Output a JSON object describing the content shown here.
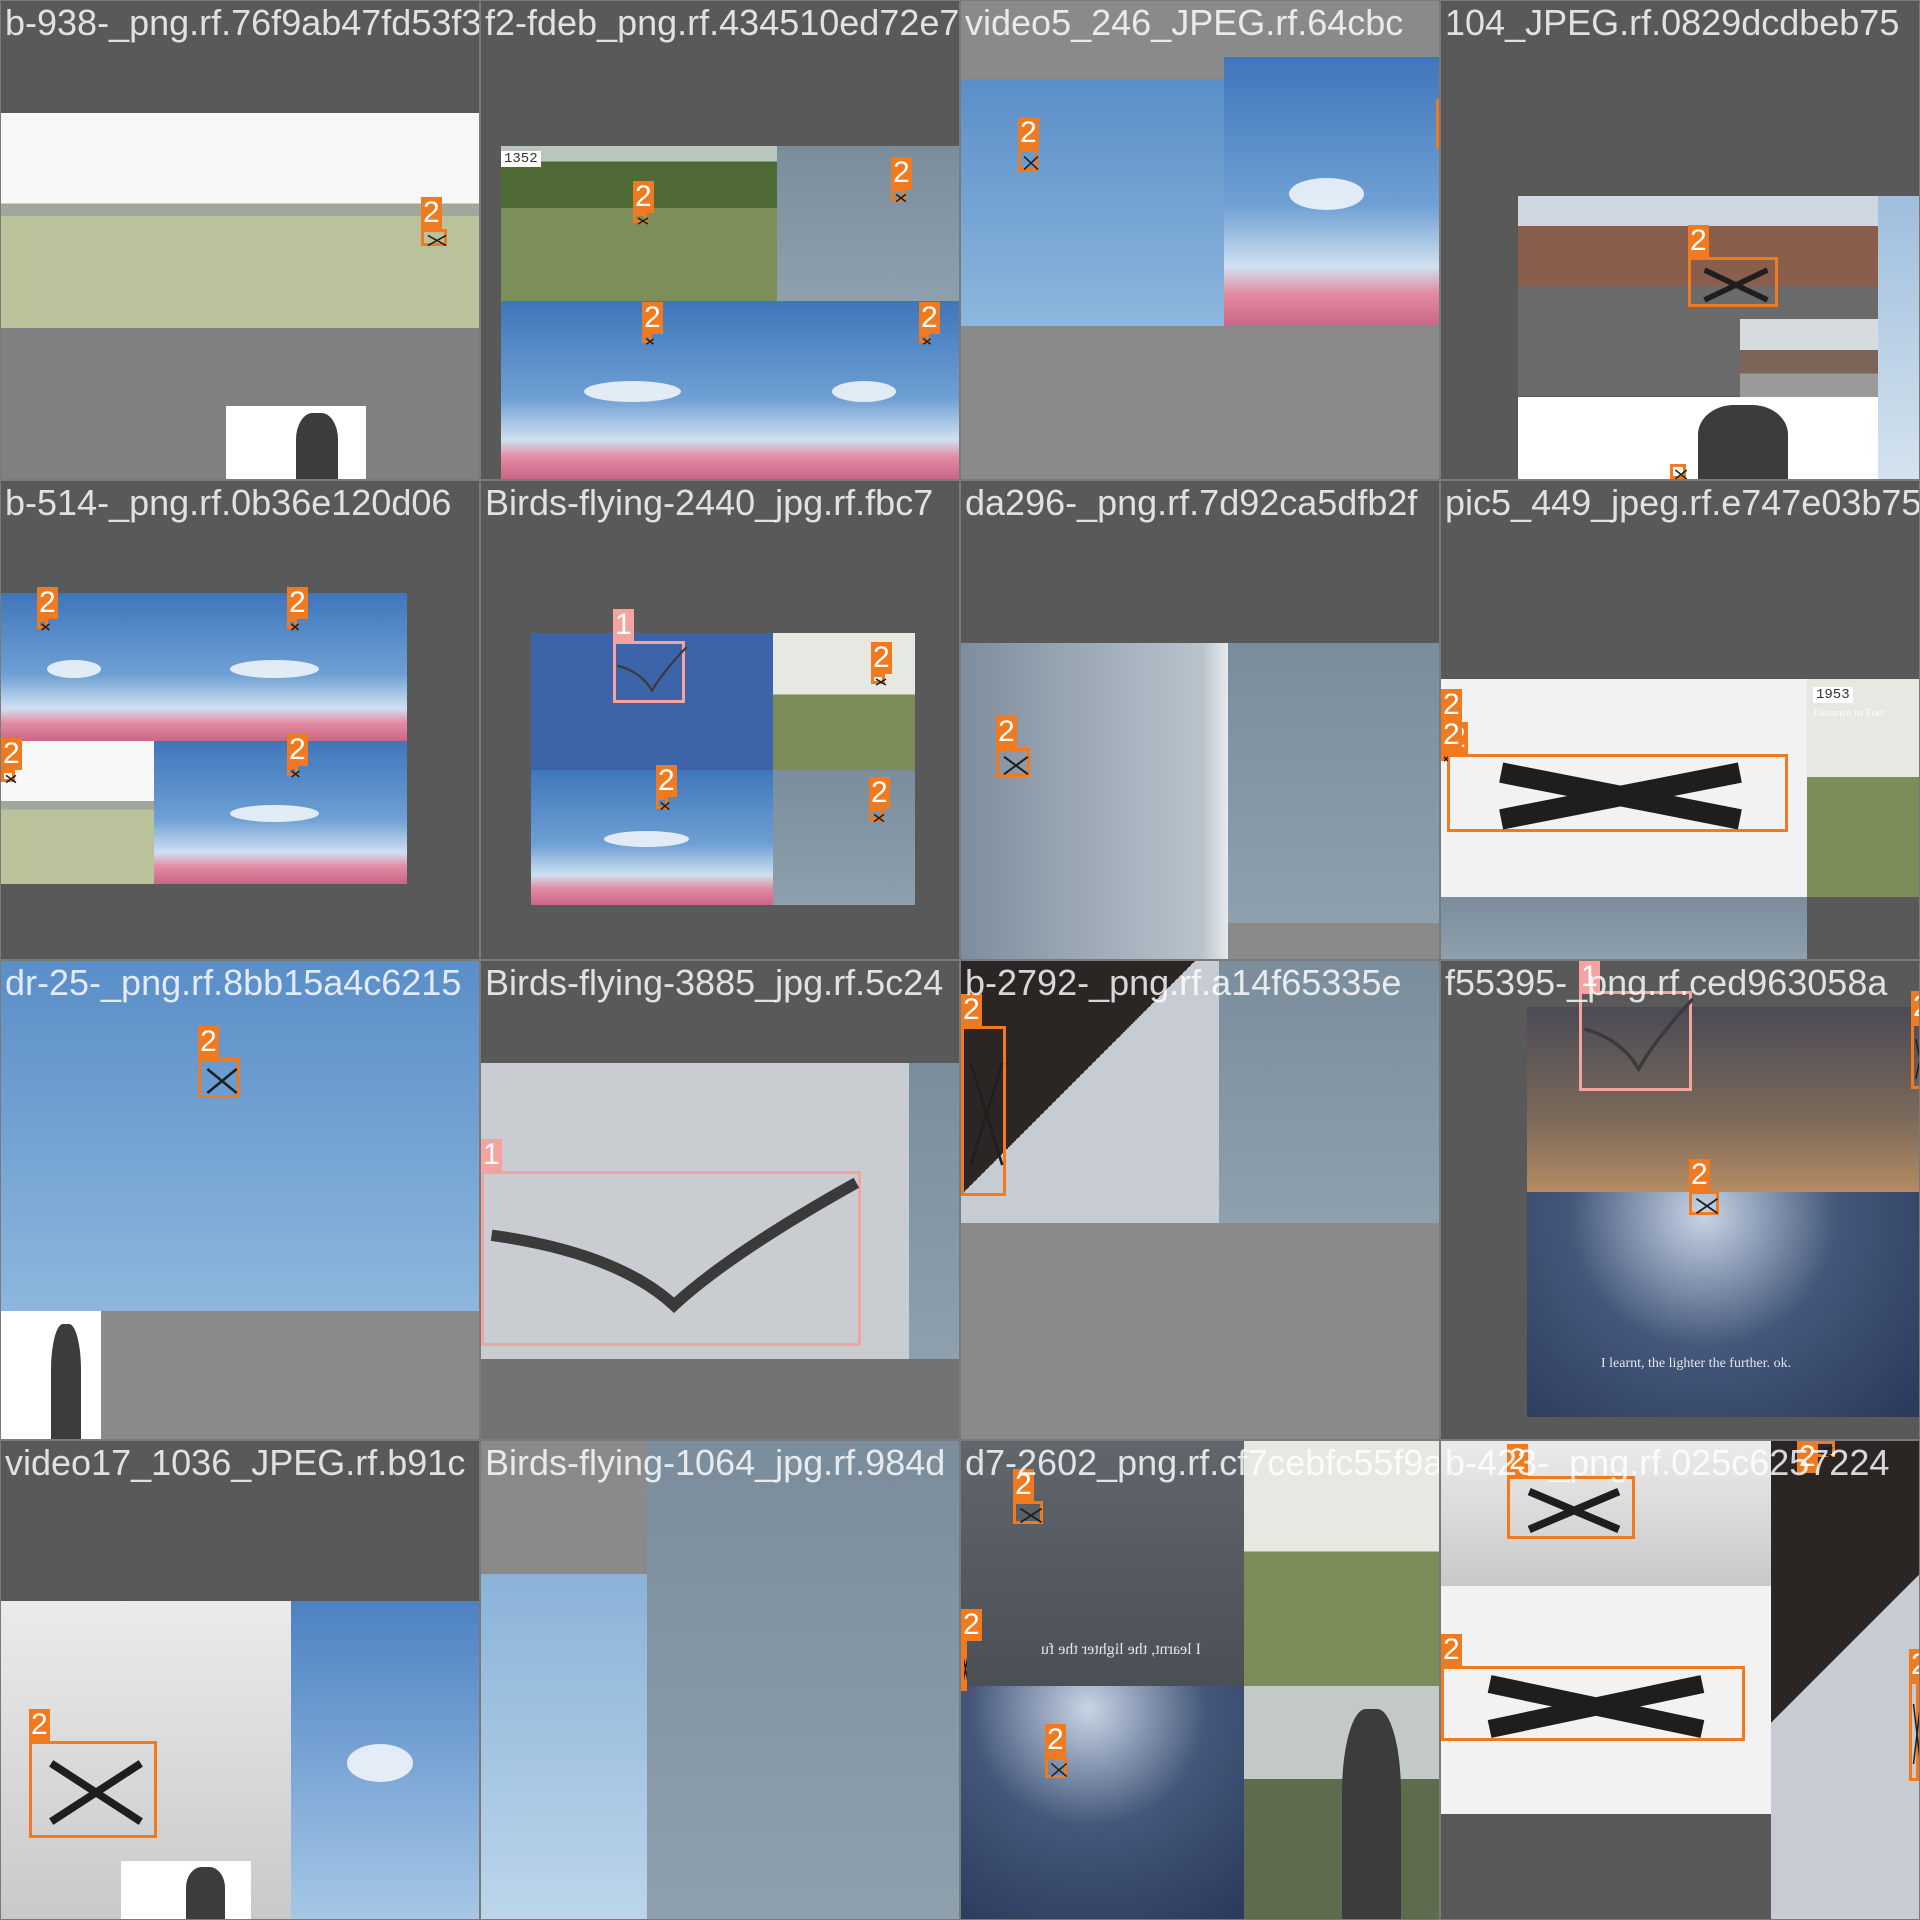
{
  "colors": {
    "drone_box": "#f07a20",
    "bird_box": "#f5a3a0",
    "pad_dark": "#595959",
    "pad_mid": "#727272",
    "pad_light": "#8a8a8a"
  },
  "tiles": [
    {
      "filename": "b-938-_png.rf.76f9ab47fd53f3238db08bef7",
      "scenes": [
        "field-with-operator",
        "operator-lower"
      ],
      "labels": [
        "2"
      ]
    },
    {
      "filename": "f2-fdeb_png.rf.434510ed72e785016",
      "scenes": [
        "aerial-field",
        "flat-sky",
        "sky-with-blossoms",
        "sky-with-blossoms"
      ],
      "overlay_number": "1352",
      "labels": [
        "2",
        "2",
        "2",
        "2"
      ]
    },
    {
      "filename": "video5_246_JPEG.rf.64cbc",
      "scenes": [
        "clear-sky",
        "sky-with-blossoms"
      ],
      "labels": [
        "2",
        "2"
      ]
    },
    {
      "filename": "104_JPEG.rf.0829dcdbeb75",
      "scenes": [
        "parking-lot",
        "building-with-trucks",
        "operator-lower",
        "sky-edge"
      ],
      "labels": [
        "2",
        "2"
      ]
    },
    {
      "filename": "b-514-_png.rf.0b36e120d06",
      "scenes": [
        "sky-with-blossoms",
        "sky-with-blossoms",
        "field-with-operator",
        "sky-with-blossoms"
      ],
      "labels": [
        "2",
        "2",
        "2",
        "2"
      ]
    },
    {
      "filename": "Birds-flying-2440_jpg.rf.fbc7",
      "scenes": [
        "bird-blue-sky",
        "grass-field",
        "sky-with-blossoms",
        "flat-sky"
      ],
      "labels": [
        "1",
        "2",
        "2",
        "2"
      ]
    },
    {
      "filename": "da296-_png.rf.7d92ca5dfb2f",
      "scenes": [
        "overcast-sky",
        "flat-sky"
      ],
      "labels": [
        "2"
      ]
    },
    {
      "filename": "pic5_449_jpeg.rf.e747e03b7561",
      "scenes": [
        "product-drone",
        "grass-field",
        "flat-sky"
      ],
      "overlay_number": "1953",
      "overlay_caption": "Distance in Feet",
      "labels": [
        "2",
        "2",
        "2"
      ]
    },
    {
      "filename": "dr-25-_png.rf.8bb15a4c6215",
      "scenes": [
        "clear-sky",
        "operator-head"
      ],
      "labels": [
        "2"
      ]
    },
    {
      "filename": "Birds-flying-3885_jpg.rf.5c24",
      "scenes": [
        "gull-grey-sky",
        "flat-sky"
      ],
      "labels": [
        "1"
      ]
    },
    {
      "filename": "b-2792-_png.rf.a14f65335e",
      "scenes": [
        "building-low-angle",
        "flat-sky"
      ],
      "labels": [
        "2"
      ]
    },
    {
      "filename": "f55395-_png.rf.ced963058a",
      "scenes": [
        "pigeon-sunset",
        "dark-sky-drone"
      ],
      "overlay_caption": "I learnt, the lighter the further. ok.",
      "labels": [
        "1",
        "2",
        "2"
      ]
    },
    {
      "filename": "video17_1036_JPEG.rf.b91c",
      "scenes": [
        "drone-below-buildings",
        "sky-with-trees",
        "operator-lower"
      ],
      "labels": [
        "2"
      ]
    },
    {
      "filename": "Birds-flying-1064_jpg.rf.984d",
      "scenes": [
        "tree-sky",
        "flat-sky"
      ],
      "labels": []
    },
    {
      "filename": "d7-2602_png.rf.cf7cebfc55f9a",
      "scenes": [
        "dark-overcast",
        "grass-field",
        "dark-sky-drone",
        "operator-portrait"
      ],
      "overlay_caption": "I learnt, the lighter the fu",
      "labels": [
        "2",
        "2",
        "2"
      ]
    },
    {
      "filename": "b-423-_png.rf.025c6257224",
      "scenes": [
        "drone-below-buildings",
        "product-drone",
        "building-low-angle"
      ],
      "labels": [
        "2",
        "2",
        "2",
        "2"
      ]
    }
  ]
}
